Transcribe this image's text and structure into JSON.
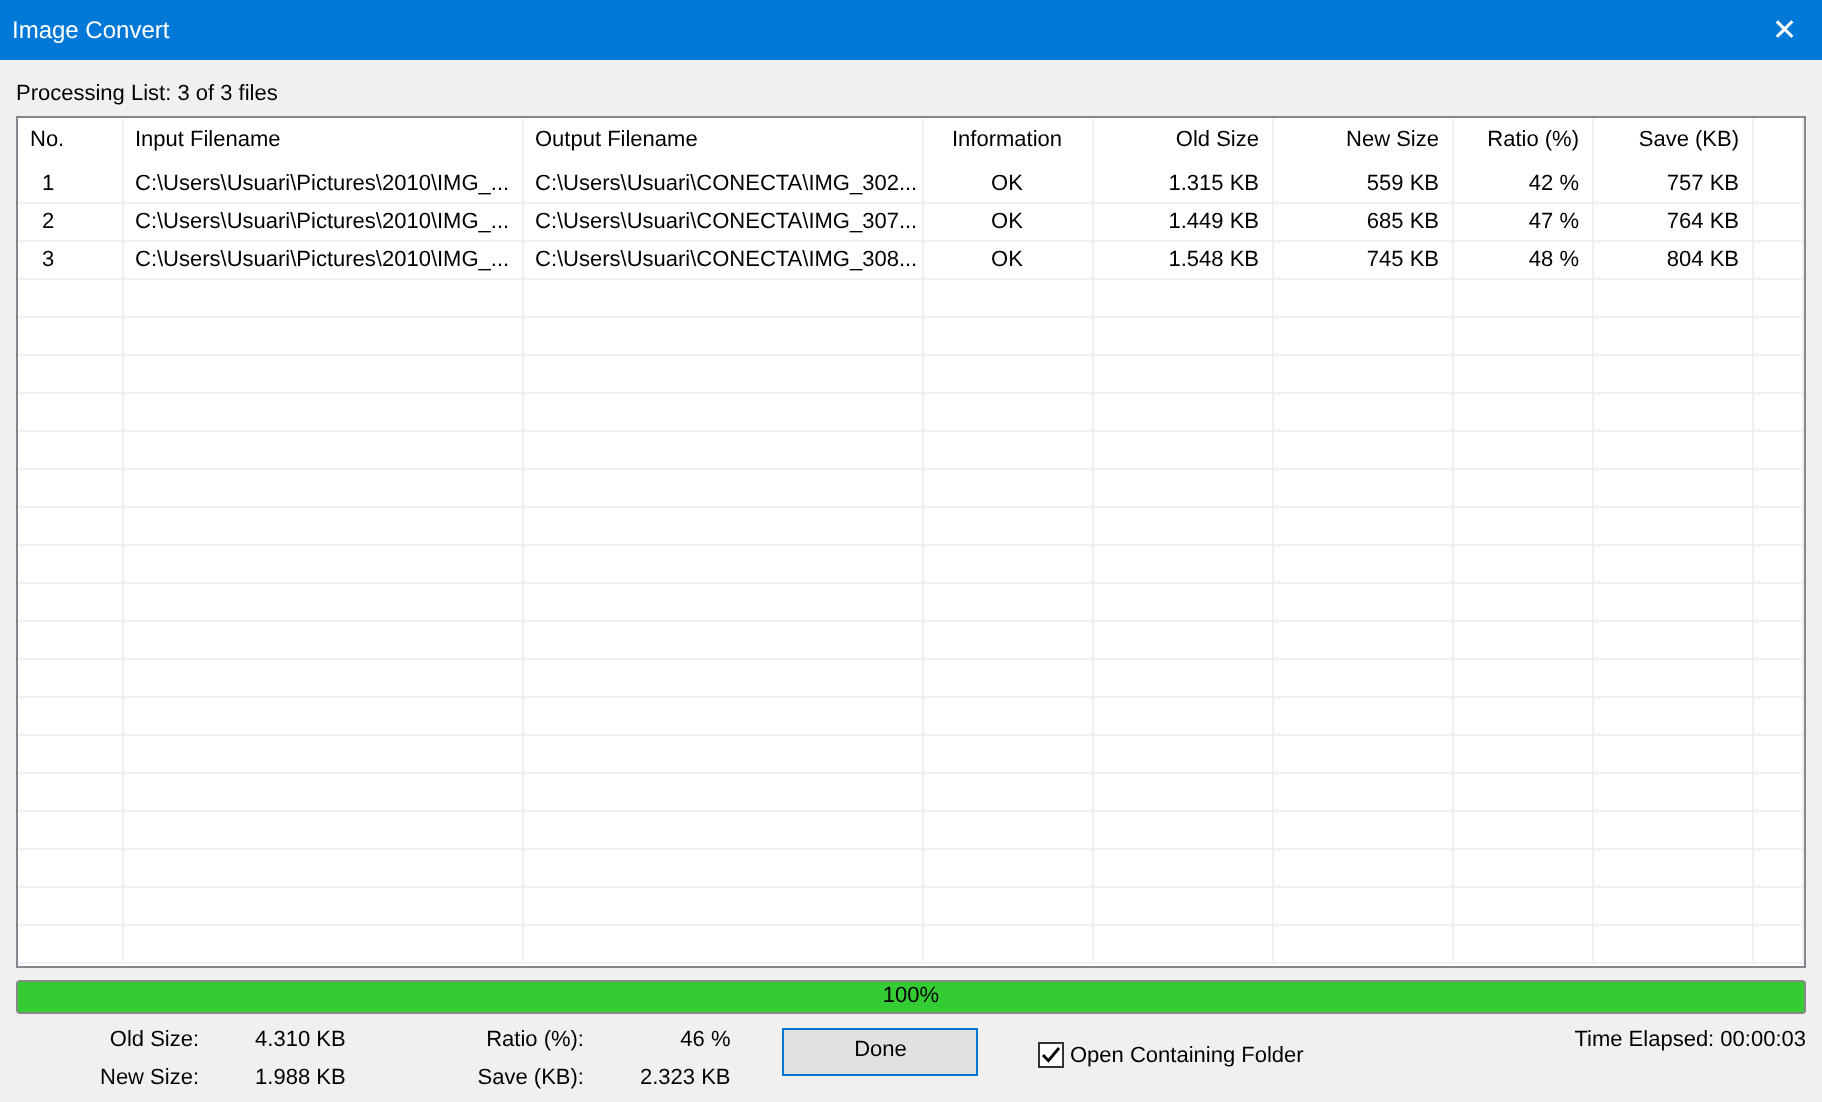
{
  "window": {
    "title": "Image Convert",
    "close": "✕"
  },
  "list_label": "Processing List: 3 of 3 files",
  "table": {
    "columns": [
      "No.",
      "Input Filename",
      "Output Filename",
      "Information",
      "Old Size",
      "New Size",
      "Ratio (%)",
      "Save (KB)"
    ],
    "rows": [
      [
        "1",
        "C:\\Users\\Usuari\\Pictures\\2010\\IMG_...",
        "C:\\Users\\Usuari\\CONECTA\\IMG_302...",
        "OK",
        "1.315 KB",
        "559 KB",
        "42 %",
        "757 KB"
      ],
      [
        "2",
        "C:\\Users\\Usuari\\Pictures\\2010\\IMG_...",
        "C:\\Users\\Usuari\\CONECTA\\IMG_307...",
        "OK",
        "1.449 KB",
        "685 KB",
        "47 %",
        "764 KB"
      ],
      [
        "3",
        "C:\\Users\\Usuari\\Pictures\\2010\\IMG_...",
        "C:\\Users\\Usuari\\CONECTA\\IMG_308...",
        "OK",
        "1.548 KB",
        "745 KB",
        "48 %",
        "804 KB"
      ]
    ]
  },
  "progress": {
    "level": 1.0,
    "text": "100%"
  },
  "summary": [
    {
      "label": "Old Size:",
      "value": "4.310 KB"
    },
    {
      "label": "New Size:",
      "value": "1.988 KB"
    },
    {
      "label": "Ratio (%):",
      "value": "46 %"
    },
    {
      "label": "Save (KB):",
      "value": "2.323 KB"
    }
  ],
  "done_button": "Done",
  "open_folder": {
    "label": "Open Containing Folder",
    "checked": true
  },
  "time_elapsed": "Time Elapsed: 00:00:03"
}
